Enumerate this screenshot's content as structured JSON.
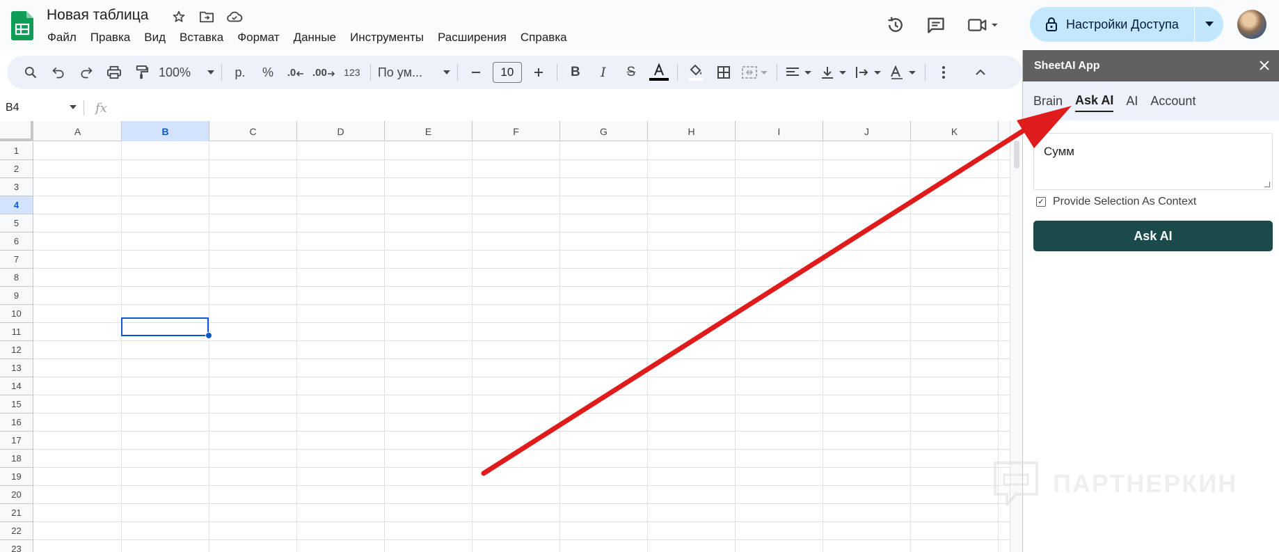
{
  "header": {
    "title": "Новая таблица",
    "menu": [
      "Файл",
      "Правка",
      "Вид",
      "Вставка",
      "Формат",
      "Данные",
      "Инструменты",
      "Расширения",
      "Справка"
    ],
    "share_label": "Настройки Доступа"
  },
  "toolbar": {
    "zoom": "100%",
    "currency": "р.",
    "percent": "%",
    "dec_decrease": ".0",
    "dec_increase": ".00",
    "number_format": "123",
    "font": "По ум...",
    "font_size": "10"
  },
  "formula_bar": {
    "name_box": "B4",
    "fx": "fx"
  },
  "grid": {
    "columns": [
      "A",
      "B",
      "C",
      "D",
      "E",
      "F",
      "G",
      "H",
      "I",
      "J",
      "K"
    ],
    "rows": [
      "1",
      "2",
      "3",
      "4",
      "5",
      "6",
      "7",
      "8",
      "9",
      "10",
      "11",
      "12",
      "13",
      "14",
      "15",
      "16",
      "17",
      "18",
      "19",
      "20",
      "21",
      "22",
      "23"
    ],
    "selected_cell": "B4"
  },
  "panel": {
    "title": "SheetAI App",
    "tabs": [
      "Brain",
      "Ask AI",
      "AI",
      "Account"
    ],
    "active_tab": "Ask AI",
    "input_value": "Сумм",
    "context_label": "Provide Selection As Context",
    "context_checked": true,
    "ask_button": "Ask AI"
  },
  "watermark": "ПАРТНЕРКИН",
  "colors": {
    "accent_blue": "#0b57d0",
    "share_bg": "#c2e7ff",
    "toolbar_bg": "#edf2fa",
    "panel_header": "#616161",
    "ask_button_bg": "#1b4a4a",
    "annotation_arrow": "#e01b1b"
  }
}
